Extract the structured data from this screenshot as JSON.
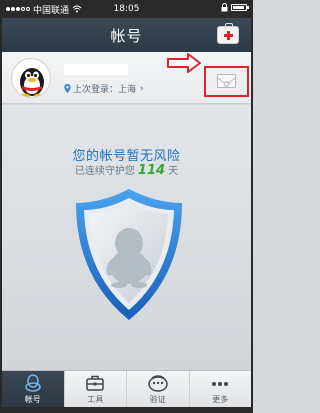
{
  "status_bar": {
    "carrier": "中国联通",
    "time": "18:05"
  },
  "nav": {
    "title": "帐号",
    "right_icon": "first-aid-kit-icon"
  },
  "profile": {
    "last_login_label": "上次登录：上海",
    "chevron": "›",
    "mail_icon": "envelope-icon"
  },
  "security": {
    "title": "您的帐号暂无风险",
    "guard_prefix": "已连续守护您",
    "days": "114",
    "guard_suffix": "天"
  },
  "tabs": [
    {
      "label": "帐号",
      "icon": "qq-penguin-icon",
      "active": true
    },
    {
      "label": "工具",
      "icon": "toolbox-icon",
      "active": false
    },
    {
      "label": "验证",
      "icon": "verify-dial-icon",
      "active": false
    },
    {
      "label": "更多",
      "icon": "more-dots-icon",
      "active": false
    }
  ],
  "colors": {
    "nav_bg": "#34414e",
    "accent_blue": "#1d73c4",
    "days_green": "#37a532",
    "highlight_red": "#d9262b"
  }
}
